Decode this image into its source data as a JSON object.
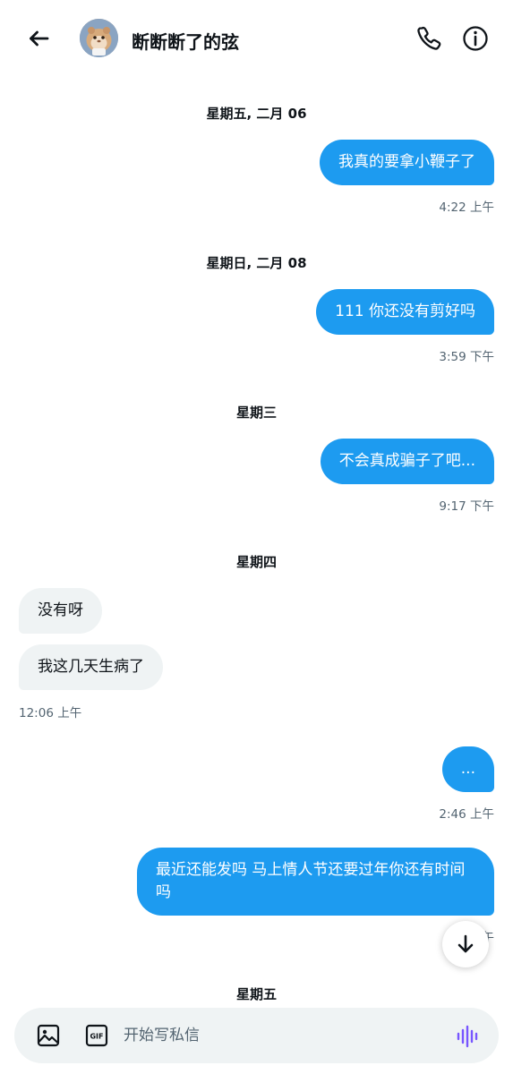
{
  "header": {
    "title": "断断断了的弦",
    "back_icon": "arrow-left-icon",
    "call_icon": "phone-icon",
    "info_icon": "info-icon"
  },
  "conversation": {
    "days": [
      {
        "label": "星期五, 二月 06"
      },
      {
        "label": "星期日, 二月 08"
      },
      {
        "label": "星期三"
      },
      {
        "label": "星期四"
      },
      {
        "label": "星期五"
      }
    ],
    "messages": [
      {
        "direction": "out",
        "text": "我真的要拿小鞭子了",
        "time": "4:22 上午"
      },
      {
        "direction": "out",
        "text": "111 你还没有剪好吗",
        "time": "3:59 下午"
      },
      {
        "direction": "out",
        "text": "不会真成骗子了吧...",
        "time": "9:17 下午"
      },
      {
        "direction": "in",
        "text": "没有呀",
        "time": ""
      },
      {
        "direction": "in",
        "text": "我这几天生病了",
        "time": "12:06 上午"
      },
      {
        "direction": "out",
        "text": "...",
        "time": "2:46 上午"
      },
      {
        "direction": "out",
        "text": "最近还能发吗 马上情人节还要过年你还有时间吗",
        "time": "午"
      }
    ]
  },
  "composer": {
    "placeholder": "开始写私信",
    "image_icon": "image-icon",
    "gif_icon": "gif-icon",
    "voice_icon": "voice-waveform-icon"
  },
  "colors": {
    "outgoing_bubble": "#1d9bf0",
    "incoming_bubble": "#eff3f4",
    "voice_accent": "#7856ff"
  }
}
